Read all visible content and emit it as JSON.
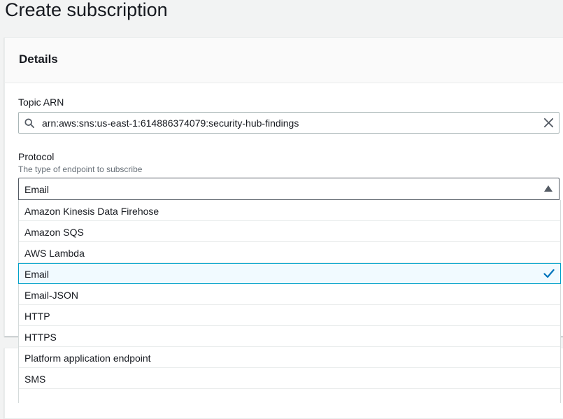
{
  "page": {
    "title": "Create subscription"
  },
  "details": {
    "title": "Details",
    "topic_arn": {
      "label": "Topic ARN",
      "value": "arn:aws:sns:us-east-1:614886374079:security-hub-findings"
    },
    "protocol": {
      "label": "Protocol",
      "description": "The type of endpoint to subscribe",
      "selected": "Email",
      "options": [
        {
          "label": "Amazon Kinesis Data Firehose"
        },
        {
          "label": "Amazon SQS"
        },
        {
          "label": "AWS Lambda"
        },
        {
          "label": "Email"
        },
        {
          "label": "Email-JSON"
        },
        {
          "label": "HTTP"
        },
        {
          "label": "HTTPS"
        },
        {
          "label": "Platform application endpoint"
        },
        {
          "label": "SMS"
        }
      ]
    }
  },
  "icons": {
    "search": "search-icon",
    "clear": "close-icon",
    "caret": "caret-up-icon",
    "check": "checkmark-icon"
  },
  "colors": {
    "accent": "#0073bb",
    "selected_border": "#00a1c9",
    "selected_bg": "#f1faff"
  }
}
